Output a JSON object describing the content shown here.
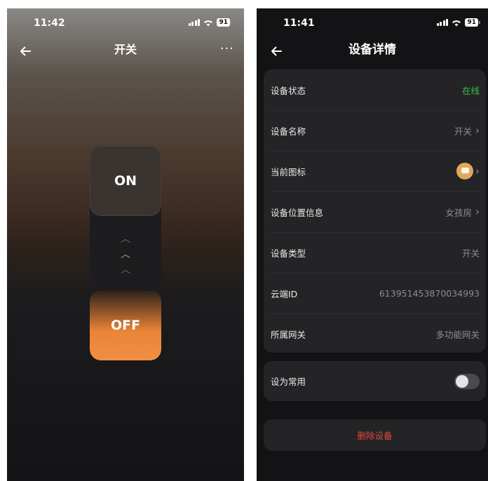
{
  "left_screen": {
    "status": {
      "time": "11:42",
      "battery": "91"
    },
    "nav": {
      "back_icon": "arrow-left-icon",
      "title": "开关",
      "more_icon": "more-horizontal-icon",
      "more_label": "···"
    },
    "switch": {
      "on_label": "ON",
      "off_label": "OFF",
      "chevron_up": "︿",
      "active_color": "#f28a3e"
    }
  },
  "right_screen": {
    "status": {
      "time": "11:41",
      "battery": "91"
    },
    "nav": {
      "back_icon": "arrow-left-icon",
      "title": "设备详情"
    },
    "rows": [
      {
        "label": "设备状态",
        "value": "在线"
      },
      {
        "label": "设备名称",
        "value": "开关"
      },
      {
        "label": "当前图标",
        "value": ""
      },
      {
        "label": "设备位置信息",
        "value": "女孩房"
      },
      {
        "label": "设备类型",
        "value": "开关"
      },
      {
        "label": "云端ID",
        "value": "613951453870034993"
      },
      {
        "label": "所属网关",
        "value": "多功能网关"
      }
    ],
    "favorite": {
      "label": "设为常用",
      "enabled": false
    },
    "delete_label": "删除设备",
    "colors": {
      "online": "#35c14c",
      "delete": "#e2483a"
    }
  }
}
